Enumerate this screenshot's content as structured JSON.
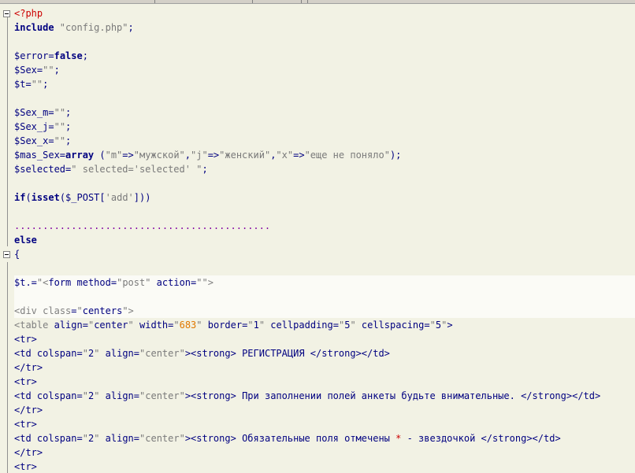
{
  "colors": {
    "background": "#f2f2e4",
    "keyword": "#000080",
    "string": "#7a7a7a",
    "php_tag": "#cc0000",
    "number": "#e07800",
    "dots": "#8000a0"
  },
  "icons": [
    "fold-collapse-icon"
  ],
  "lines": [
    {
      "id": "l1",
      "segs": [
        {
          "cls": "t-php",
          "text": "<?php"
        }
      ]
    },
    {
      "id": "l2",
      "segs": [
        {
          "cls": "t-kw",
          "text": "include"
        },
        {
          "cls": "t-str",
          "text": " \"config.php\""
        },
        {
          "cls": "t-op",
          "text": ";"
        }
      ]
    },
    {
      "id": "l3",
      "segs": []
    },
    {
      "id": "l4",
      "segs": [
        {
          "cls": "t-var",
          "text": "$error"
        },
        {
          "cls": "t-op",
          "text": "="
        },
        {
          "cls": "t-kw",
          "text": "false"
        },
        {
          "cls": "t-op",
          "text": ";"
        }
      ]
    },
    {
      "id": "l5",
      "segs": [
        {
          "cls": "t-var",
          "text": "$Sex"
        },
        {
          "cls": "t-op",
          "text": "="
        },
        {
          "cls": "t-str",
          "text": "\"\""
        },
        {
          "cls": "t-op",
          "text": ";"
        }
      ]
    },
    {
      "id": "l6",
      "segs": [
        {
          "cls": "t-var",
          "text": "$t"
        },
        {
          "cls": "t-op",
          "text": "="
        },
        {
          "cls": "t-str",
          "text": "\"\""
        },
        {
          "cls": "t-op",
          "text": ";"
        }
      ]
    },
    {
      "id": "l7",
      "segs": []
    },
    {
      "id": "l8",
      "segs": [
        {
          "cls": "t-var",
          "text": "$Sex_m"
        },
        {
          "cls": "t-op",
          "text": "="
        },
        {
          "cls": "t-str",
          "text": "\"\""
        },
        {
          "cls": "t-op",
          "text": ";"
        }
      ]
    },
    {
      "id": "l9",
      "segs": [
        {
          "cls": "t-var",
          "text": "$Sex_j"
        },
        {
          "cls": "t-op",
          "text": "="
        },
        {
          "cls": "t-str",
          "text": "\"\""
        },
        {
          "cls": "t-op",
          "text": ";"
        }
      ]
    },
    {
      "id": "l10",
      "segs": [
        {
          "cls": "t-var",
          "text": "$Sex_x"
        },
        {
          "cls": "t-op",
          "text": "="
        },
        {
          "cls": "t-str",
          "text": "\"\""
        },
        {
          "cls": "t-op",
          "text": ";"
        }
      ]
    },
    {
      "id": "l11",
      "segs": [
        {
          "cls": "t-var",
          "text": "$mas_Sex"
        },
        {
          "cls": "t-op",
          "text": "="
        },
        {
          "cls": "t-kw",
          "text": "array"
        },
        {
          "cls": "t-paren",
          "text": " ("
        },
        {
          "cls": "t-str",
          "text": "\"m\""
        },
        {
          "cls": "t-op",
          "text": "=>"
        },
        {
          "cls": "t-str",
          "text": "\"мужской\""
        },
        {
          "cls": "t-op",
          "text": ","
        },
        {
          "cls": "t-str",
          "text": "\"j\""
        },
        {
          "cls": "t-op",
          "text": "=>"
        },
        {
          "cls": "t-str",
          "text": "\"женский\""
        },
        {
          "cls": "t-op",
          "text": ","
        },
        {
          "cls": "t-str",
          "text": "\"x\""
        },
        {
          "cls": "t-op",
          "text": "=>"
        },
        {
          "cls": "t-str",
          "text": "\"еще не поняло\""
        },
        {
          "cls": "t-paren",
          "text": ")"
        },
        {
          "cls": "t-op",
          "text": ";"
        }
      ]
    },
    {
      "id": "l12",
      "segs": [
        {
          "cls": "t-var",
          "text": "$selected"
        },
        {
          "cls": "t-op",
          "text": "="
        },
        {
          "cls": "t-str",
          "text": "\" selected='selected' \""
        },
        {
          "cls": "t-op",
          "text": ";"
        }
      ]
    },
    {
      "id": "l13",
      "segs": []
    },
    {
      "id": "l14",
      "segs": [
        {
          "cls": "t-kw",
          "text": "if"
        },
        {
          "cls": "t-paren",
          "text": "("
        },
        {
          "cls": "t-kw",
          "text": "isset"
        },
        {
          "cls": "t-paren",
          "text": "("
        },
        {
          "cls": "t-var",
          "text": "$_POST"
        },
        {
          "cls": "t-paren",
          "text": "["
        },
        {
          "cls": "t-str",
          "text": "'add'"
        },
        {
          "cls": "t-paren",
          "text": "]))"
        }
      ]
    },
    {
      "id": "l15",
      "segs": []
    },
    {
      "id": "l16",
      "segs": [
        {
          "cls": "t-dots",
          "text": "............................................."
        }
      ]
    },
    {
      "id": "l17",
      "segs": [
        {
          "cls": "t-kw",
          "text": "else"
        }
      ]
    },
    {
      "id": "l18",
      "segs": [
        {
          "cls": "t-paren",
          "text": "{"
        }
      ]
    },
    {
      "id": "l19",
      "segs": []
    },
    {
      "id": "l20",
      "hl": true,
      "segs": [
        {
          "cls": "t-var",
          "text": "$t"
        },
        {
          "cls": "t-op",
          "text": ".="
        },
        {
          "cls": "t-str",
          "text": "\""
        },
        {
          "cls": "t-mu",
          "text": "<"
        },
        {
          "cls": "t-html",
          "text": "form method"
        },
        {
          "cls": "t-op",
          "text": "="
        },
        {
          "cls": "t-str",
          "text": "\"post\""
        },
        {
          "cls": "t-attr",
          "text": " action"
        },
        {
          "cls": "t-op",
          "text": "="
        },
        {
          "cls": "t-str",
          "text": "\"\""
        },
        {
          "cls": "t-mu",
          "text": ">"
        },
        {
          "cls": "t-html",
          "text": " "
        }
      ]
    },
    {
      "id": "l21",
      "hl": true,
      "segs": []
    },
    {
      "id": "l22",
      "hl": true,
      "segs": [
        {
          "cls": "t-mu",
          "text": "<"
        },
        {
          "cls": "t-mu",
          "text": "div "
        },
        {
          "cls": "t-mu",
          "text": "class"
        },
        {
          "cls": "t-op",
          "text": "="
        },
        {
          "cls": "t-str",
          "text": "\""
        },
        {
          "cls": "t-html",
          "text": "centers"
        },
        {
          "cls": "t-str",
          "text": "\""
        },
        {
          "cls": "t-mu",
          "text": ">"
        },
        {
          "cls": "t-html",
          "text": " "
        }
      ]
    },
    {
      "id": "l23",
      "segs": [
        {
          "cls": "t-mu",
          "text": "<"
        },
        {
          "cls": "t-mu",
          "text": "table "
        },
        {
          "cls": "t-attr",
          "text": "align"
        },
        {
          "cls": "t-op",
          "text": "="
        },
        {
          "cls": "t-str",
          "text": "\""
        },
        {
          "cls": "t-html",
          "text": "center"
        },
        {
          "cls": "t-str",
          "text": "\""
        },
        {
          "cls": "t-attr",
          "text": " width"
        },
        {
          "cls": "t-op",
          "text": "="
        },
        {
          "cls": "t-str",
          "text": "\""
        },
        {
          "cls": "t-num",
          "text": "683"
        },
        {
          "cls": "t-str",
          "text": "\""
        },
        {
          "cls": "t-attr",
          "text": " border"
        },
        {
          "cls": "t-op",
          "text": "="
        },
        {
          "cls": "t-str",
          "text": "\""
        },
        {
          "cls": "t-html",
          "text": "1"
        },
        {
          "cls": "t-str",
          "text": "\""
        },
        {
          "cls": "t-attr",
          "text": " cellpadding"
        },
        {
          "cls": "t-op",
          "text": "="
        },
        {
          "cls": "t-str",
          "text": "\""
        },
        {
          "cls": "t-html",
          "text": "5"
        },
        {
          "cls": "t-str",
          "text": "\""
        },
        {
          "cls": "t-attr",
          "text": " cellspacing"
        },
        {
          "cls": "t-op",
          "text": "="
        },
        {
          "cls": "t-str",
          "text": "\""
        },
        {
          "cls": "t-html",
          "text": "5"
        },
        {
          "cls": "t-str",
          "text": "\""
        },
        {
          "cls": "t-html",
          "text": ">"
        }
      ]
    },
    {
      "id": "l24",
      "segs": [
        {
          "cls": "t-html",
          "text": "<tr>"
        }
      ]
    },
    {
      "id": "l25",
      "segs": [
        {
          "cls": "t-html",
          "text": "<td colspan"
        },
        {
          "cls": "t-op",
          "text": "="
        },
        {
          "cls": "t-str",
          "text": "\""
        },
        {
          "cls": "t-html",
          "text": "2"
        },
        {
          "cls": "t-str",
          "text": "\""
        },
        {
          "cls": "t-attr",
          "text": " align"
        },
        {
          "cls": "t-op",
          "text": "="
        },
        {
          "cls": "t-str",
          "text": "\"center\""
        },
        {
          "cls": "t-html",
          "text": "><strong>"
        },
        {
          "cls": "t-text",
          "text": " РЕГИСТРАЦИЯ "
        },
        {
          "cls": "t-html",
          "text": "</strong></td>"
        }
      ]
    },
    {
      "id": "l26",
      "segs": [
        {
          "cls": "t-html",
          "text": "</tr>"
        }
      ]
    },
    {
      "id": "l27",
      "segs": [
        {
          "cls": "t-html",
          "text": "<tr>"
        }
      ]
    },
    {
      "id": "l28",
      "segs": [
        {
          "cls": "t-html",
          "text": "<td colspan"
        },
        {
          "cls": "t-op",
          "text": "="
        },
        {
          "cls": "t-str",
          "text": "\""
        },
        {
          "cls": "t-html",
          "text": "2"
        },
        {
          "cls": "t-str",
          "text": "\""
        },
        {
          "cls": "t-attr",
          "text": " align"
        },
        {
          "cls": "t-op",
          "text": "="
        },
        {
          "cls": "t-str",
          "text": "\"center\""
        },
        {
          "cls": "t-html",
          "text": "><strong>"
        },
        {
          "cls": "t-text",
          "text": " При заполнении полей анкеты будьте внимательные. "
        },
        {
          "cls": "t-html",
          "text": "</strong></td>"
        }
      ]
    },
    {
      "id": "l29",
      "segs": [
        {
          "cls": "t-html",
          "text": "</tr>"
        }
      ]
    },
    {
      "id": "l30",
      "segs": [
        {
          "cls": "t-html",
          "text": "<tr>"
        }
      ]
    },
    {
      "id": "l31",
      "segs": [
        {
          "cls": "t-html",
          "text": "<td colspan"
        },
        {
          "cls": "t-op",
          "text": "="
        },
        {
          "cls": "t-str",
          "text": "\""
        },
        {
          "cls": "t-html",
          "text": "2"
        },
        {
          "cls": "t-str",
          "text": "\""
        },
        {
          "cls": "t-attr",
          "text": " align"
        },
        {
          "cls": "t-op",
          "text": "="
        },
        {
          "cls": "t-str",
          "text": "\"center\""
        },
        {
          "cls": "t-html",
          "text": "><strong>"
        },
        {
          "cls": "t-text",
          "text": " Обязательные поля отмечены "
        },
        {
          "cls": "t-star",
          "text": "*"
        },
        {
          "cls": "t-text",
          "text": " - звездочкой "
        },
        {
          "cls": "t-html",
          "text": "</strong></td>"
        }
      ]
    },
    {
      "id": "l32",
      "segs": [
        {
          "cls": "t-html",
          "text": "</tr>"
        }
      ]
    },
    {
      "id": "l33",
      "segs": [
        {
          "cls": "t-html",
          "text": "<tr>"
        }
      ]
    }
  ]
}
